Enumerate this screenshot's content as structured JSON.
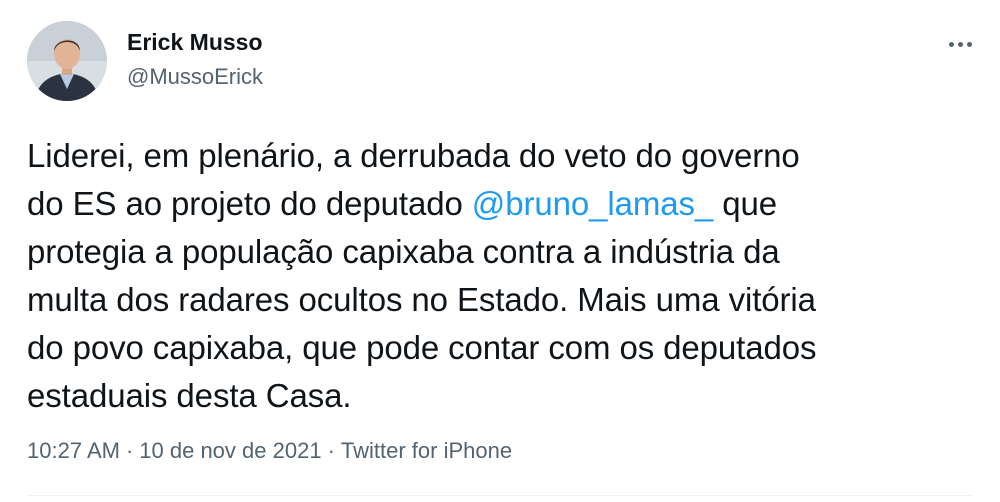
{
  "author": {
    "name": "Erick Musso",
    "handle": "@MussoErick"
  },
  "tweet": {
    "line1": "Liderei, em plenário, a derrubada do veto do governo",
    "line2_before": "do ES ao projeto do deputado ",
    "mention": "@bruno_lamas_",
    "line2_after": " que",
    "line3": "protegia a população capixaba contra a indústria da",
    "line4": "multa dos radares ocultos no Estado. Mais uma vitória",
    "line5": "do povo capixaba, que pode contar com os deputados",
    "line6": "estaduais desta Casa."
  },
  "meta": {
    "time": "10:27 AM",
    "separator": "·",
    "date": "10 de nov de 2021",
    "source": "Twitter for iPhone"
  },
  "icons": {
    "more": "more-horizontal-icon"
  },
  "colors": {
    "text": "#0f1419",
    "secondary": "#536471",
    "link": "#1d9bf0"
  }
}
